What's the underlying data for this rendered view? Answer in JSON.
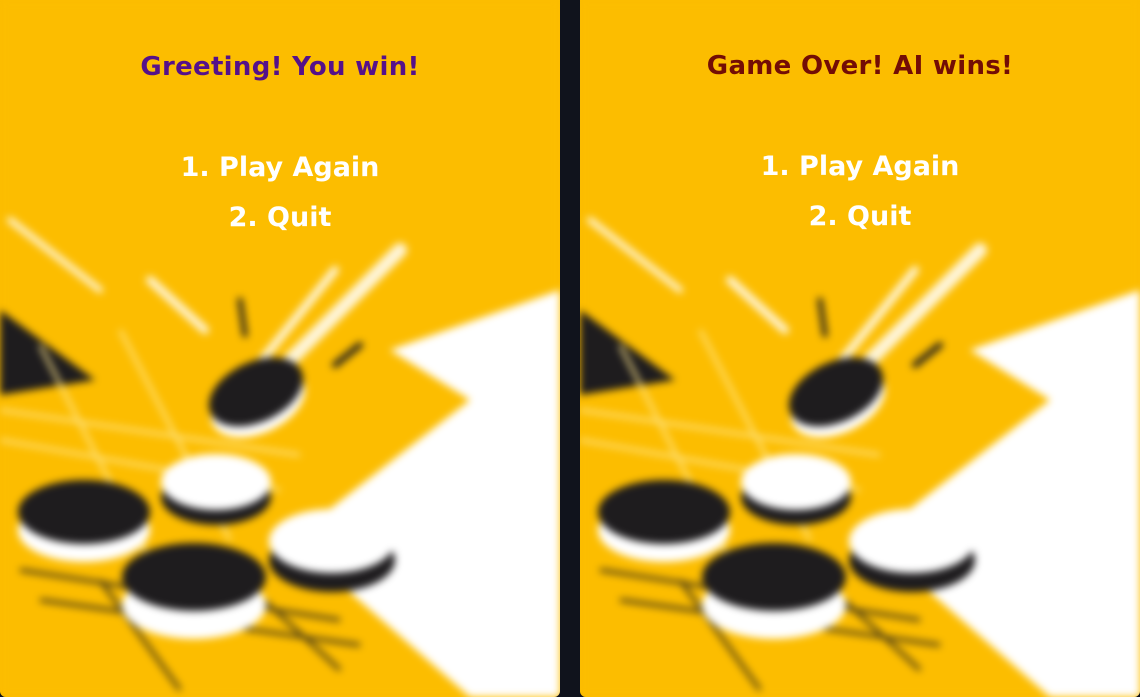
{
  "colors": {
    "background": "#fcbd00",
    "divider": "#10131c",
    "menu_text": "#ffffff",
    "win_title": "#55118a",
    "lose_title": "#730d05",
    "disc_black": "#1e1c1e",
    "disc_white": "#ffffff"
  },
  "screens": [
    {
      "title": "Greeting! You win!",
      "options": [
        {
          "label": "1. Play Again"
        },
        {
          "label": "2. Quit"
        }
      ]
    },
    {
      "title": "Game Over! AI wins!",
      "options": [
        {
          "label": "1. Play Again"
        },
        {
          "label": "2. Quit"
        }
      ]
    }
  ]
}
